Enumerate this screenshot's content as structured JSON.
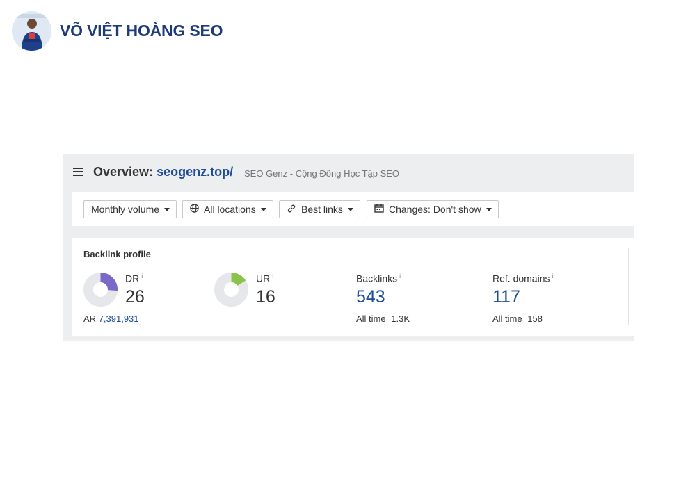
{
  "brand": {
    "name": "VÕ VIỆT HOÀNG SEO"
  },
  "overview": {
    "label": "Overview:",
    "domain": "seogenz.top/",
    "site_title": "SEO Genz - Cộng Đồng Học Tập SEO"
  },
  "filters": {
    "volume": "Monthly volume",
    "locations": "All locations",
    "links": "Best links",
    "changes": "Changes: Don't show"
  },
  "backlink_profile": {
    "title": "Backlink profile",
    "dr": {
      "label": "DR",
      "info": "i",
      "value": "26",
      "fill_fraction": 0.26,
      "color": "#7b68c8"
    },
    "ar": {
      "label": "AR",
      "value": "7,391,931"
    },
    "ur": {
      "label": "UR",
      "info": "i",
      "value": "16",
      "fill_fraction": 0.16,
      "color": "#8bc34a"
    },
    "backlinks": {
      "label": "Backlinks",
      "info": "i",
      "value": "543",
      "sub_label": "All time",
      "sub_value": "1.3K"
    },
    "ref_domains": {
      "label": "Ref. domains",
      "info": "i",
      "value": "117",
      "sub_label": "All time",
      "sub_value": "158"
    }
  }
}
